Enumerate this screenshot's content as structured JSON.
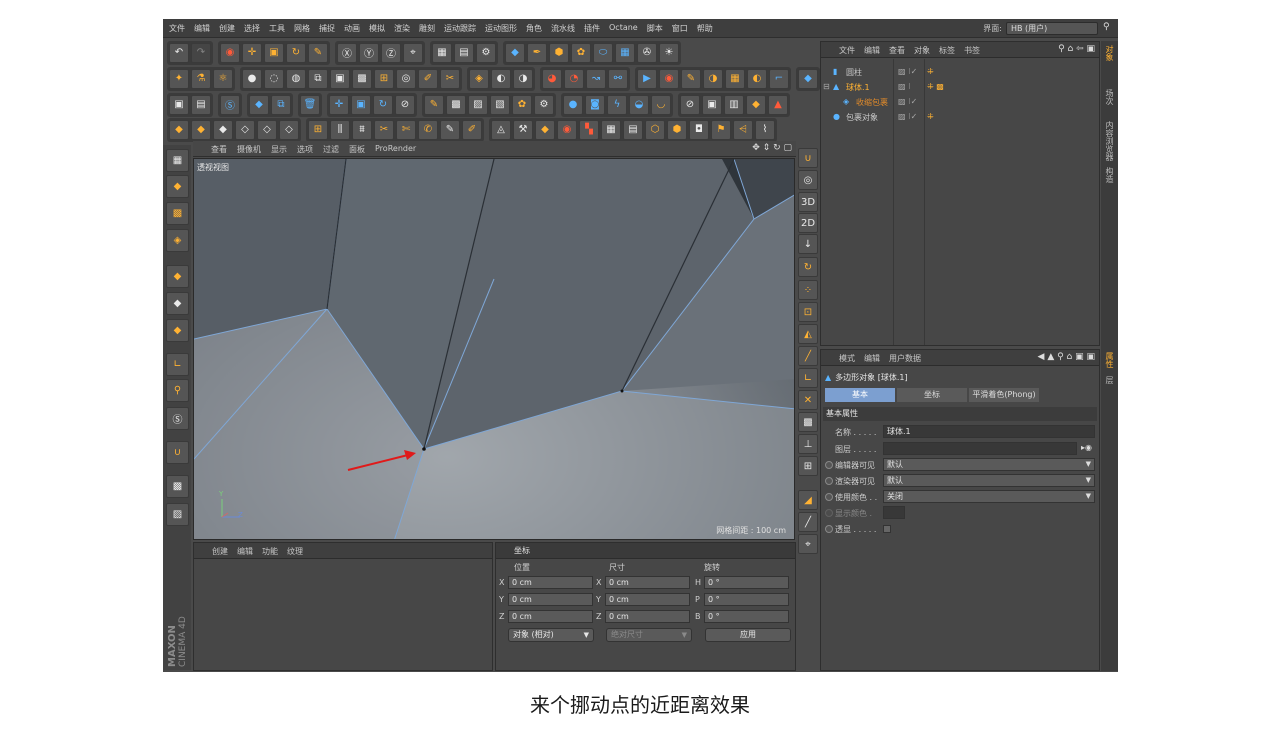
{
  "menubar": {
    "items": [
      "文件",
      "编辑",
      "创建",
      "选择",
      "工具",
      "网格",
      "捕捉",
      "动画",
      "模拟",
      "渲染",
      "雕刻",
      "运动跟踪",
      "运动图形",
      "角色",
      "流水线",
      "插件",
      "Octane",
      "脚本",
      "窗口",
      "帮助"
    ],
    "layout_label": "界面:",
    "layout_value": "HB (用户)"
  },
  "viewport": {
    "menu": [
      "查看",
      "摄像机",
      "显示",
      "选项",
      "过滤",
      "面板",
      "ProRender"
    ],
    "label": "透视视图",
    "grid_distance": "网格间距 : 100 cm",
    "axis_y": "Y",
    "axis_z": "Z"
  },
  "object_manager": {
    "menu": [
      "文件",
      "编辑",
      "查看",
      "对象",
      "标签",
      "书签"
    ],
    "objects": [
      {
        "name": "圆柱",
        "color": "#c8c8c8"
      },
      {
        "name": "球体.1",
        "color": "#ffb233"
      },
      {
        "name": "收缩包裹",
        "color": "#e08a2a"
      },
      {
        "name": "包裹对象",
        "color": "#c8c8c8"
      }
    ]
  },
  "side_tabs": [
    "对象",
    "场次",
    "内容浏览器",
    "构造",
    "属性",
    "层"
  ],
  "attributes": {
    "menu": [
      "模式",
      "编辑",
      "用户数据"
    ],
    "title": "多边形对象 [球体.1]",
    "tabs": [
      "基本",
      "坐标",
      "平滑着色(Phong)"
    ],
    "section": "基本属性",
    "fields": [
      {
        "label": "名称 . . . . .",
        "value": "球体.1",
        "kind": "text"
      },
      {
        "label": "图层 . . . . .",
        "value": "",
        "kind": "layer"
      },
      {
        "label": "编辑器可见",
        "value": "默认",
        "kind": "select"
      },
      {
        "label": "渲染器可见",
        "value": "默认",
        "kind": "select"
      },
      {
        "label": "使用颜色 . .",
        "value": "关闭",
        "kind": "select"
      },
      {
        "label": "显示颜色 .",
        "value": "",
        "kind": "color"
      },
      {
        "label": "透显 . . . . .",
        "value": "",
        "kind": "check"
      }
    ]
  },
  "material_panel": {
    "menu": [
      "创建",
      "编辑",
      "功能",
      "纹理"
    ]
  },
  "coordinates": {
    "title": "坐标",
    "columns": [
      "位置",
      "尺寸",
      "旋转"
    ],
    "rows": [
      {
        "a1": "X",
        "v1": "0 cm",
        "a2": "X",
        "v2": "0 cm",
        "a3": "H",
        "v3": "0 °"
      },
      {
        "a1": "Y",
        "v1": "0 cm",
        "a2": "Y",
        "v2": "0 cm",
        "a3": "P",
        "v3": "0 °"
      },
      {
        "a1": "Z",
        "v1": "0 cm",
        "a2": "Z",
        "v2": "0 cm",
        "a3": "B",
        "v3": "0 °"
      }
    ],
    "mode": "对象 (相对)",
    "size_mode": "绝对尺寸",
    "apply": "应用"
  },
  "branding": {
    "line1": "MAXON",
    "line2": "CINEMA 4D"
  },
  "caption": "来个挪动点的近距离效果",
  "colors": {
    "accent": "#ffb233",
    "selection": "#7c9fd0",
    "arrow": "#e01a1a",
    "edge": "#7fa7d6"
  }
}
